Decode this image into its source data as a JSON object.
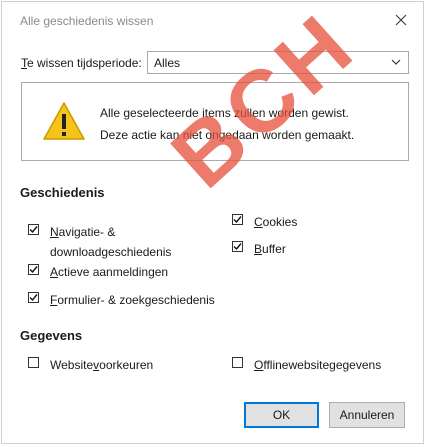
{
  "dialog": {
    "title": "Alle geschiedenis wissen",
    "icons": {
      "close": "close-icon",
      "warning": "warning-icon",
      "dropdown": "chevron-down-icon"
    }
  },
  "period": {
    "label_underlined": "T",
    "label_rest": "e wissen tijdsperiode:",
    "selected": "Alles"
  },
  "warning": {
    "line1": "Alle geselecteerde items zullen worden gewist.",
    "line2": "Deze actie kan niet ongedaan worden gemaakt."
  },
  "history": {
    "heading": "Geschiedenis",
    "items": [
      {
        "u": "N",
        "rest": "avigatie- &",
        "line2": "downloadgeschiedenis",
        "checked": true
      },
      {
        "u": "A",
        "rest": "ctieve aanmeldingen",
        "checked": true
      },
      {
        "u": "F",
        "rest": "ormulier- & zoekgeschiedenis",
        "checked": true
      },
      {
        "u": "C",
        "rest": "ookies",
        "checked": true
      },
      {
        "u": "B",
        "rest": "uffer",
        "checked": true
      }
    ]
  },
  "data_section": {
    "heading": "Gegevens",
    "items": [
      {
        "pre": "Website",
        "u": "v",
        "rest": "oorkeuren",
        "checked": false
      },
      {
        "pre": "",
        "u": "O",
        "rest": "fflinewebsitegegevens",
        "checked": false
      }
    ]
  },
  "watermark": "BCH",
  "buttons": {
    "ok": "OK",
    "cancel": "Annuleren"
  },
  "colors": {
    "accent": "#0078d7",
    "watermark": "#e8503a",
    "warning_fill": "#f5c31c"
  }
}
